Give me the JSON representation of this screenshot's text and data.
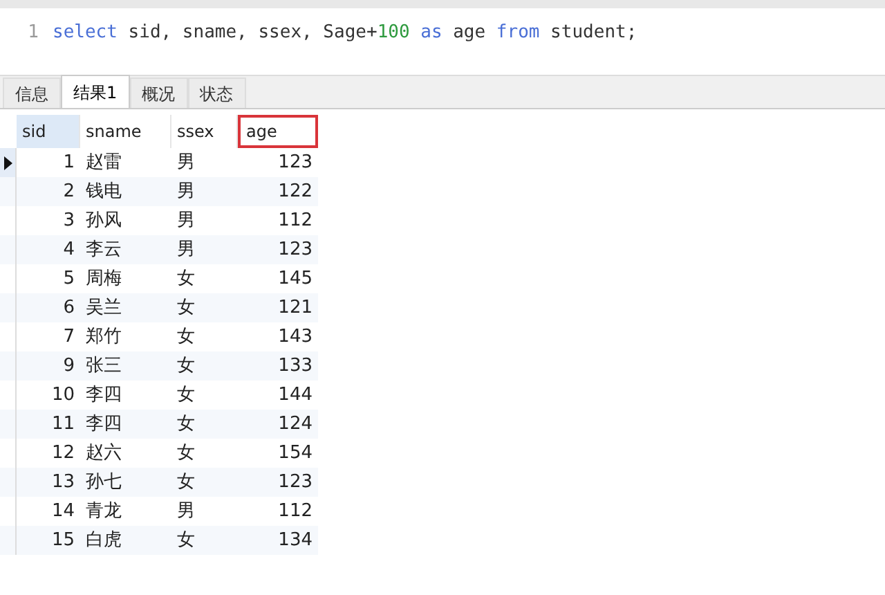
{
  "editor": {
    "line_number": "1",
    "tokens": [
      {
        "kind": "keyword",
        "text": "select"
      },
      {
        "kind": "plain",
        "text": " sid, sname, ssex, Sage+"
      },
      {
        "kind": "number",
        "text": "100"
      },
      {
        "kind": "keyword",
        "text": " as"
      },
      {
        "kind": "plain",
        "text": " age "
      },
      {
        "kind": "keyword",
        "text": "from"
      },
      {
        "kind": "plain",
        "text": " student;"
      }
    ]
  },
  "tabs": [
    {
      "label": "信息",
      "selected": false
    },
    {
      "label": "结果1",
      "selected": true
    },
    {
      "label": "概况",
      "selected": false
    },
    {
      "label": "状态",
      "selected": false
    }
  ],
  "table": {
    "columns": [
      {
        "label": "sid",
        "highlighted": false,
        "focused": true
      },
      {
        "label": "sname",
        "highlighted": false,
        "focused": false
      },
      {
        "label": "ssex",
        "highlighted": false,
        "focused": false
      },
      {
        "label": "age",
        "highlighted": true,
        "focused": false
      }
    ],
    "rows": [
      {
        "current": true,
        "cells": [
          "1",
          "赵雷",
          "男",
          "123"
        ]
      },
      {
        "current": false,
        "cells": [
          "2",
          "钱电",
          "男",
          "122"
        ]
      },
      {
        "current": false,
        "cells": [
          "3",
          "孙风",
          "男",
          "112"
        ]
      },
      {
        "current": false,
        "cells": [
          "4",
          "李云",
          "男",
          "123"
        ]
      },
      {
        "current": false,
        "cells": [
          "5",
          "周梅",
          "女",
          "145"
        ]
      },
      {
        "current": false,
        "cells": [
          "6",
          "吴兰",
          "女",
          "121"
        ]
      },
      {
        "current": false,
        "cells": [
          "7",
          "郑竹",
          "女",
          "143"
        ]
      },
      {
        "current": false,
        "cells": [
          "9",
          "张三",
          "女",
          "133"
        ]
      },
      {
        "current": false,
        "cells": [
          "10",
          "李四",
          "女",
          "144"
        ]
      },
      {
        "current": false,
        "cells": [
          "11",
          "李四",
          "女",
          "124"
        ]
      },
      {
        "current": false,
        "cells": [
          "12",
          "赵六",
          "女",
          "154"
        ]
      },
      {
        "current": false,
        "cells": [
          "13",
          "孙七",
          "女",
          "123"
        ]
      },
      {
        "current": false,
        "cells": [
          "14",
          "青龙",
          "男",
          "112"
        ]
      },
      {
        "current": false,
        "cells": [
          "15",
          "白虎",
          "女",
          "134"
        ]
      }
    ]
  }
}
